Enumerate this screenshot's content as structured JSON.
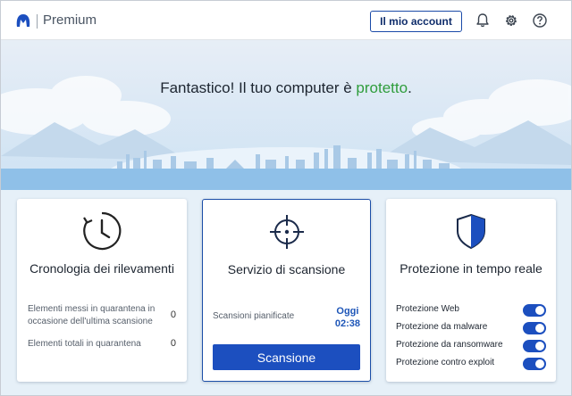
{
  "header": {
    "brand_label": "Premium",
    "account_button": "Il mio account",
    "icons": [
      "bell-icon",
      "gear-icon",
      "help-icon"
    ]
  },
  "hero": {
    "headline_prefix": "Fantastico! Il tuo computer è ",
    "headline_status": "protetto",
    "headline_suffix": "."
  },
  "cards": {
    "history": {
      "icon": "clock-icon",
      "title": "Cronologia dei rilevamenti",
      "stats": [
        {
          "label": "Elementi messi in quarantena in occasione dell'ultima scansione",
          "value": "0"
        },
        {
          "label": "Elementi totali in quarantena",
          "value": "0"
        }
      ]
    },
    "scan": {
      "icon": "crosshair-icon",
      "title": "Servizio di scansione",
      "scheduled_label": "Scansioni pianificate",
      "scheduled_day": "Oggi",
      "scheduled_time": "02:38",
      "scan_button": "Scansione"
    },
    "realtime": {
      "icon": "shield-icon",
      "title": "Protezione in tempo reale",
      "protections": [
        {
          "label": "Protezione Web",
          "enabled": true
        },
        {
          "label": "Protezione da malware",
          "enabled": true
        },
        {
          "label": "Protezione da ransomware",
          "enabled": true
        },
        {
          "label": "Protezione contro exploit",
          "enabled": true
        }
      ]
    }
  },
  "colors": {
    "accent": "#1c4fbf",
    "status_ok": "#2f9d3c",
    "navy": "#0f2d6b"
  }
}
